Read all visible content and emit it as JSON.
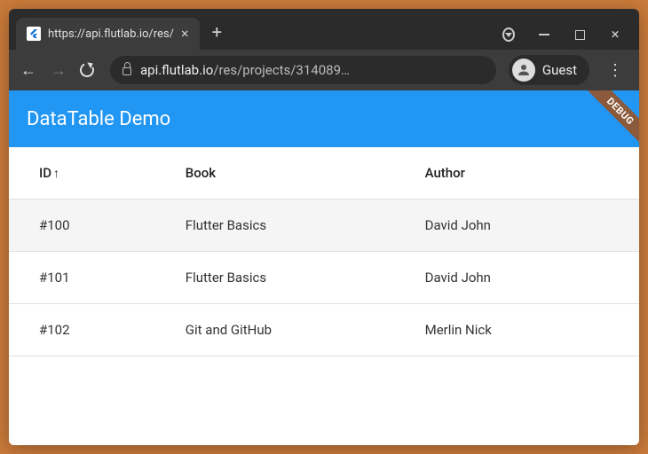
{
  "browser": {
    "tab_title": "https://api.flutlab.io/res/",
    "url_host": "api.flutlab.io",
    "url_path": "/res/projects/314089…",
    "guest_label": "Guest"
  },
  "app": {
    "title": "DataTable Demo",
    "debug_banner": "DEBUG"
  },
  "table": {
    "columns": {
      "id": "ID",
      "book": "Book",
      "author": "Author"
    },
    "sort_indicator": "↑",
    "rows": [
      {
        "id": "#100",
        "book": "Flutter Basics",
        "author": "David John"
      },
      {
        "id": "#101",
        "book": "Flutter Basics",
        "author": "David John"
      },
      {
        "id": "#102",
        "book": "Git and GitHub",
        "author": "Merlin Nick"
      }
    ]
  }
}
